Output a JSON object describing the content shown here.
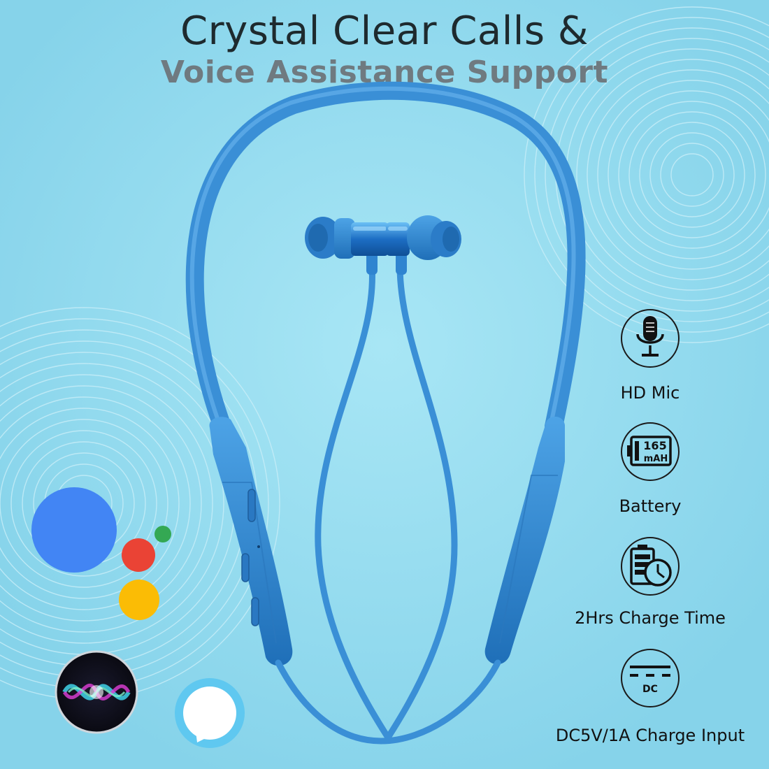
{
  "headline": {
    "line1": "Crystal Clear Calls &",
    "line2": "Voice Assistance Support"
  },
  "features": [
    {
      "icon": "microphone-icon",
      "label": "HD Mic"
    },
    {
      "icon": "battery-icon",
      "label": "Battery",
      "icon_value": "165",
      "icon_unit": "mAH"
    },
    {
      "icon": "charge-time-icon",
      "label": "2Hrs Charge Time"
    },
    {
      "icon": "dc-power-icon",
      "label": "DC5V/1A Charge Input",
      "icon_text": "DC"
    }
  ],
  "assistants": [
    "google-assistant-logo",
    "siri-logo",
    "alexa-logo"
  ],
  "colors": {
    "background": "#8fd9ee",
    "product_blue": "#3a8fd6",
    "headline_dark": "#1e2a2e",
    "headline_gray": "#6f7a80",
    "google_blue": "#4285f4",
    "google_red": "#ea4335",
    "google_yellow": "#fbbc05",
    "google_green": "#34a853",
    "alexa_blue": "#5fc8f0"
  }
}
